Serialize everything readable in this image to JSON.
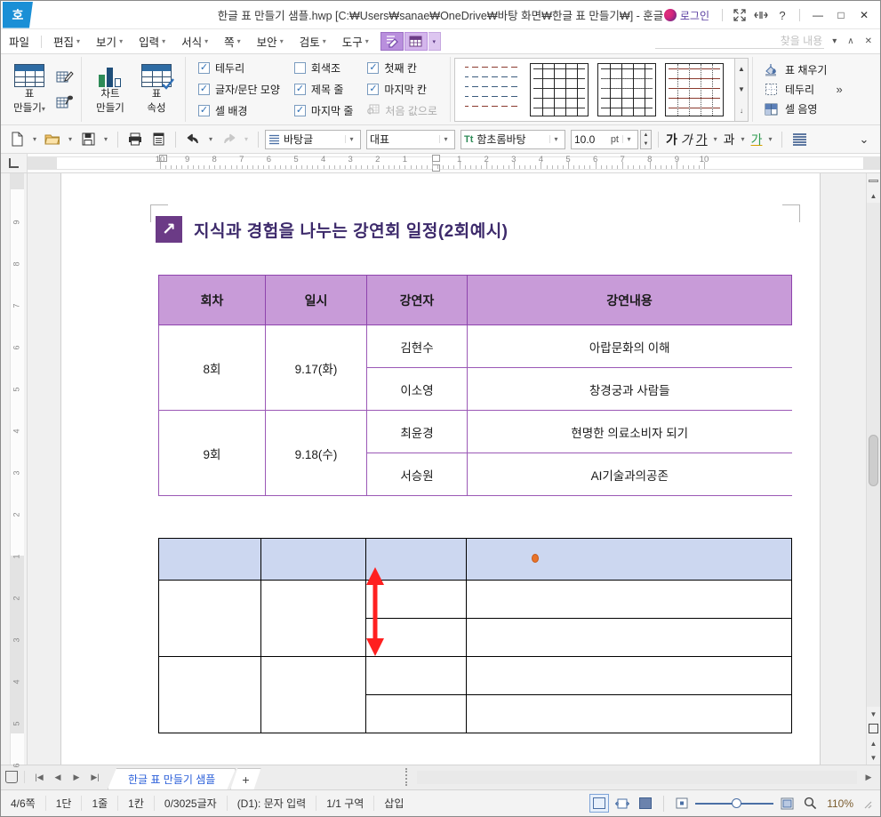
{
  "window": {
    "app_logo": "호",
    "title": "한글 표 만들기 샘플.hwp [C:₩Users₩sanae₩OneDrive₩바탕 화면₩한글 표 만들기₩] - 훈글",
    "login_label": "로그인",
    "icons": {
      "fullscreen": "⛶",
      "ribbon_toggle": "⇿",
      "help": "?"
    },
    "controls": {
      "minimize": "—",
      "maximize": "□",
      "close": "✕"
    }
  },
  "menubar": {
    "items": [
      {
        "label": "파일",
        "caret": false
      },
      {
        "label": "편집",
        "caret": true
      },
      {
        "label": "보기",
        "caret": true
      },
      {
        "label": "입력",
        "caret": true
      },
      {
        "label": "서식",
        "caret": true
      },
      {
        "label": "쪽",
        "caret": true
      },
      {
        "label": "보안",
        "caret": true
      },
      {
        "label": "검토",
        "caret": true
      },
      {
        "label": "도구",
        "caret": true
      }
    ],
    "caret_glyph": "▾"
  },
  "find": {
    "placeholder": "찾을 내용",
    "caret": "▾",
    "up": "∧",
    "close": "✕"
  },
  "ribbon": {
    "table_group": {
      "make_table_line1": "표",
      "make_table_line2": "만들기",
      "make_table_caret": "▾"
    },
    "chart_group": {
      "chart_line1": "차트",
      "chart_line2": "만들기",
      "props_line1": "표",
      "props_line2": "속성"
    },
    "options": [
      {
        "label": "테두리",
        "checked": true,
        "disabled": false
      },
      {
        "label": "글자/문단 모양",
        "checked": true,
        "disabled": false
      },
      {
        "label": "셀 배경",
        "checked": true,
        "disabled": false
      },
      {
        "label": "회색조",
        "checked": false,
        "disabled": false
      },
      {
        "label": "제목 줄",
        "checked": true,
        "disabled": false
      },
      {
        "label": "마지막 줄",
        "checked": true,
        "disabled": false
      },
      {
        "label": "첫째 칸",
        "checked": true,
        "disabled": false
      },
      {
        "label": "마지막 칸",
        "checked": true,
        "disabled": false
      },
      {
        "label": "처음 값으로",
        "checked": false,
        "disabled": true
      }
    ],
    "check_glyph": "✓",
    "gallery_scroll": {
      "up": "▲",
      "down": "▼",
      "more": "↓"
    },
    "right_commands": [
      {
        "label": "표 채우기",
        "icon": "fill-icon"
      },
      {
        "label": "테두리",
        "icon": "border-icon"
      },
      {
        "label": "셀 음영",
        "icon": "shade-icon"
      }
    ],
    "expand": "»"
  },
  "format_toolbar": {
    "style_combo": {
      "value": "바탕글",
      "caret": "▾"
    },
    "preset_combo": {
      "value": "대표",
      "caret": "▾"
    },
    "font_combo": {
      "value": "함초롬바탕",
      "caret": "▾",
      "icon": "Tt"
    },
    "size_combo": {
      "value": "10.0",
      "unit": "pt",
      "caret": "▾"
    },
    "bold": "가",
    "italic": "가",
    "underline": "가",
    "strike": "과",
    "color": "가",
    "align": "≣",
    "overflow": "⌄"
  },
  "ruler": {
    "left_numbers": [
      "10",
      "9",
      "8",
      "7",
      "6",
      "5",
      "4",
      "3",
      "2",
      "1"
    ],
    "right_numbers": [
      "1",
      "2",
      "3",
      "4",
      "5",
      "6",
      "7",
      "8",
      "9",
      "10"
    ],
    "vertical_numbers": [
      "9",
      "8",
      "7",
      "6",
      "5",
      "4",
      "3",
      "2",
      "1",
      "2",
      "3",
      "4",
      "5",
      "6"
    ]
  },
  "document": {
    "heading": {
      "icon": "↗",
      "text": "지식과 경험을 나누는 강연회 일정(2회예시)"
    },
    "lecture_table": {
      "headers": [
        "회차",
        "일시",
        "강연자",
        "강연내용"
      ],
      "rows": [
        {
          "session": "8회",
          "date": "9.17(화)",
          "entries": [
            {
              "speaker": "김현수",
              "topic": "아랍문화의 이해"
            },
            {
              "speaker": "이소영",
              "topic": "창경궁과 사람들"
            }
          ]
        },
        {
          "session": "9회",
          "date": "9.18(수)",
          "entries": [
            {
              "speaker": "최윤경",
              "topic": "현명한 의료소비자 되기"
            },
            {
              "speaker": "서승원",
              "topic": "AI기술과의공존"
            }
          ]
        }
      ]
    },
    "empty_table": {
      "columns": 4,
      "header_row_cells": [
        "",
        "",
        "",
        ""
      ],
      "body_rows": [
        [
          "",
          "",
          "",
          ""
        ],
        [
          "",
          "",
          "",
          ""
        ],
        [
          "",
          "",
          "",
          ""
        ],
        [
          "",
          "",
          "",
          ""
        ]
      ]
    },
    "annotation": {
      "type": "double-arrow",
      "color": "#ff2020"
    },
    "cursor_marker": {
      "color": "#e8732a"
    }
  },
  "tabbar": {
    "nav": {
      "first": "|◀",
      "prev": "◀",
      "next": "▶",
      "last": "▶|"
    },
    "document_tab": "한글 표 만들기 샘플",
    "new_tab": "+"
  },
  "statusbar": {
    "fields": [
      "4/6쪽",
      "1단",
      "1줄",
      "1칸",
      "0/3025글자",
      "(D1): 문자 입력",
      "1/1 구역",
      "삽입"
    ],
    "zoom_level": "110%",
    "search_icon": "search-icon"
  },
  "colors": {
    "accent_purple": "#9b59b6",
    "table_header_purple": "#c89bd8",
    "heading_purple": "#3d2a6b",
    "table_header_blue": "#ccd7f0",
    "annotation_red": "#ff2020",
    "cursor_orange": "#e8732a",
    "login_purple": "#5a3fa0",
    "title_blue": "#1a8fd6"
  }
}
